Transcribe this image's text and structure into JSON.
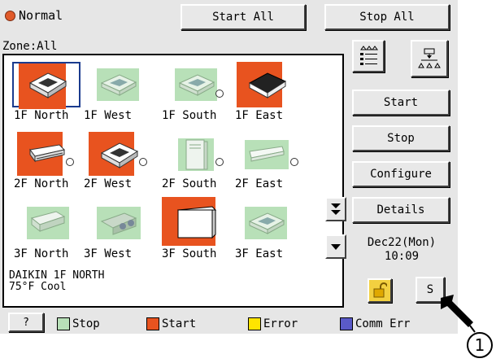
{
  "header": {
    "mode_label": "Normal",
    "start_all_label": "Start All",
    "stop_all_label": "Stop All",
    "zone_label": "Zone:All"
  },
  "units": [
    {
      "label": "1F North",
      "state": "start",
      "type": "cassette-4way",
      "selected": true
    },
    {
      "label": "1F West",
      "state": "stop",
      "type": "cassette-4way"
    },
    {
      "label": "1F South",
      "state": "stop",
      "type": "cassette-4way",
      "indicator": true
    },
    {
      "label": "1F East",
      "state": "start",
      "type": "cassette-black"
    },
    {
      "label": "2F North",
      "state": "start",
      "type": "ceiling-suspended",
      "indicator": true
    },
    {
      "label": "2F West",
      "state": "start",
      "type": "cassette-4way",
      "indicator": true
    },
    {
      "label": "2F South",
      "state": "stop",
      "type": "floor-standing",
      "indicator": true
    },
    {
      "label": "2F East",
      "state": "stop",
      "type": "wall-mounted",
      "indicator": true
    },
    {
      "label": "3F North",
      "state": "stop",
      "type": "duct"
    },
    {
      "label": "3F West",
      "state": "stop",
      "type": "duct-fan"
    },
    {
      "label": "3F South",
      "state": "start",
      "type": "floor-cabinet"
    },
    {
      "label": "3F East",
      "state": "stop",
      "type": "cassette-4way"
    }
  ],
  "info": {
    "line1": "DAIKIN 1F NORTH",
    "line2": "75°F  Cool"
  },
  "side_buttons": {
    "start": "Start",
    "stop": "Stop",
    "configure": "Configure",
    "details": "Details",
    "s_button": "S"
  },
  "datetime": {
    "date": "Dec22(Mon)",
    "time": "10:09"
  },
  "legend": {
    "help": "?",
    "stop": "Stop",
    "start": "Start",
    "error": "Error",
    "comm_err": "Comm Err"
  },
  "colors": {
    "start": "#e8531f",
    "stop": "#b8e0b8",
    "error": "#ffe400",
    "comm_err": "#5a5ac8",
    "selected_border": "#1a3b8e"
  },
  "callout": {
    "number": "1"
  }
}
